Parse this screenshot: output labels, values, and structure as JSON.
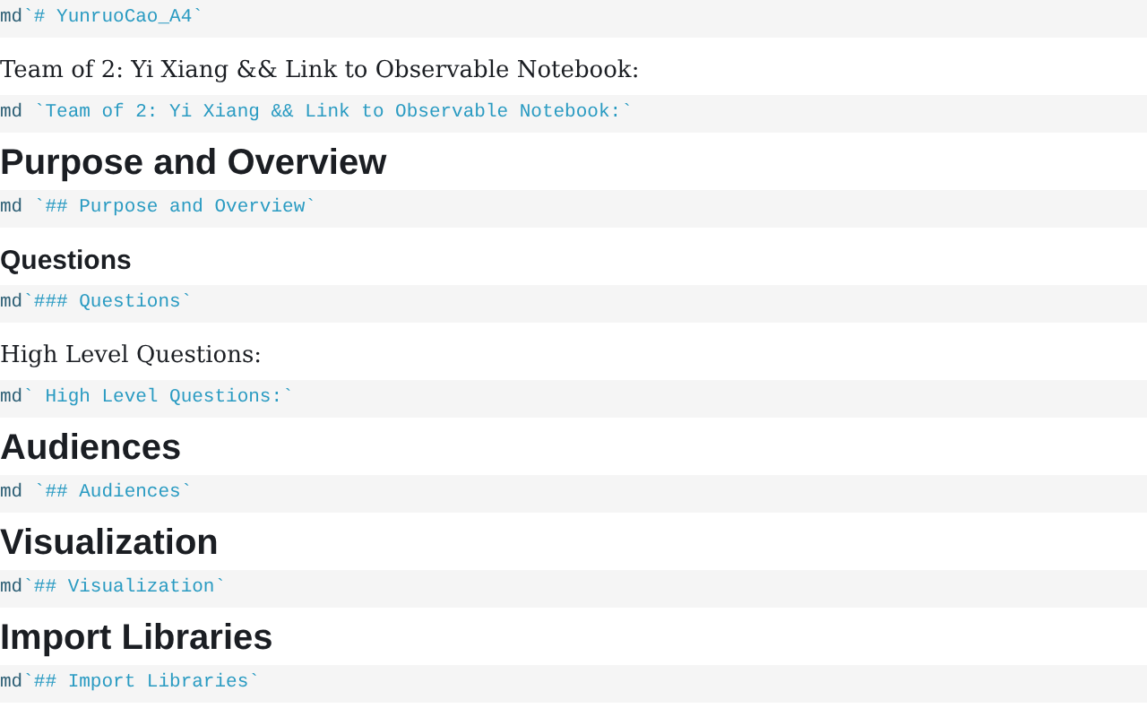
{
  "cells": [
    {
      "source": {
        "tag": "md",
        "code": "`# YunruoCao_A4`"
      }
    },
    {
      "output": {
        "kind": "paragraph",
        "text": "Team of 2: Yi Xiang && Link to Observable Notebook:"
      },
      "source": {
        "tag": "md",
        "code": " `Team of 2: Yi Xiang && Link to Observable Notebook:`"
      }
    },
    {
      "output": {
        "kind": "h2",
        "text": "Purpose and Overview"
      },
      "source": {
        "tag": "md",
        "code": " `## Purpose and Overview`"
      }
    },
    {
      "output": {
        "kind": "h3",
        "text": "Questions"
      },
      "source": {
        "tag": "md",
        "code": "`### Questions`"
      }
    },
    {
      "output": {
        "kind": "paragraph",
        "text": "High Level Questions:"
      },
      "source": {
        "tag": "md",
        "code": "` High Level Questions:`"
      }
    },
    {
      "output": {
        "kind": "h2",
        "text": "Audiences"
      },
      "source": {
        "tag": "md",
        "code": " `## Audiences`"
      }
    },
    {
      "output": {
        "kind": "h2",
        "text": "Visualization"
      },
      "source": {
        "tag": "md",
        "code": "`## Visualization`"
      }
    },
    {
      "output": {
        "kind": "h2",
        "text": "Import Libraries"
      },
      "source": {
        "tag": "md",
        "code": "`## Import Libraries`"
      }
    }
  ]
}
